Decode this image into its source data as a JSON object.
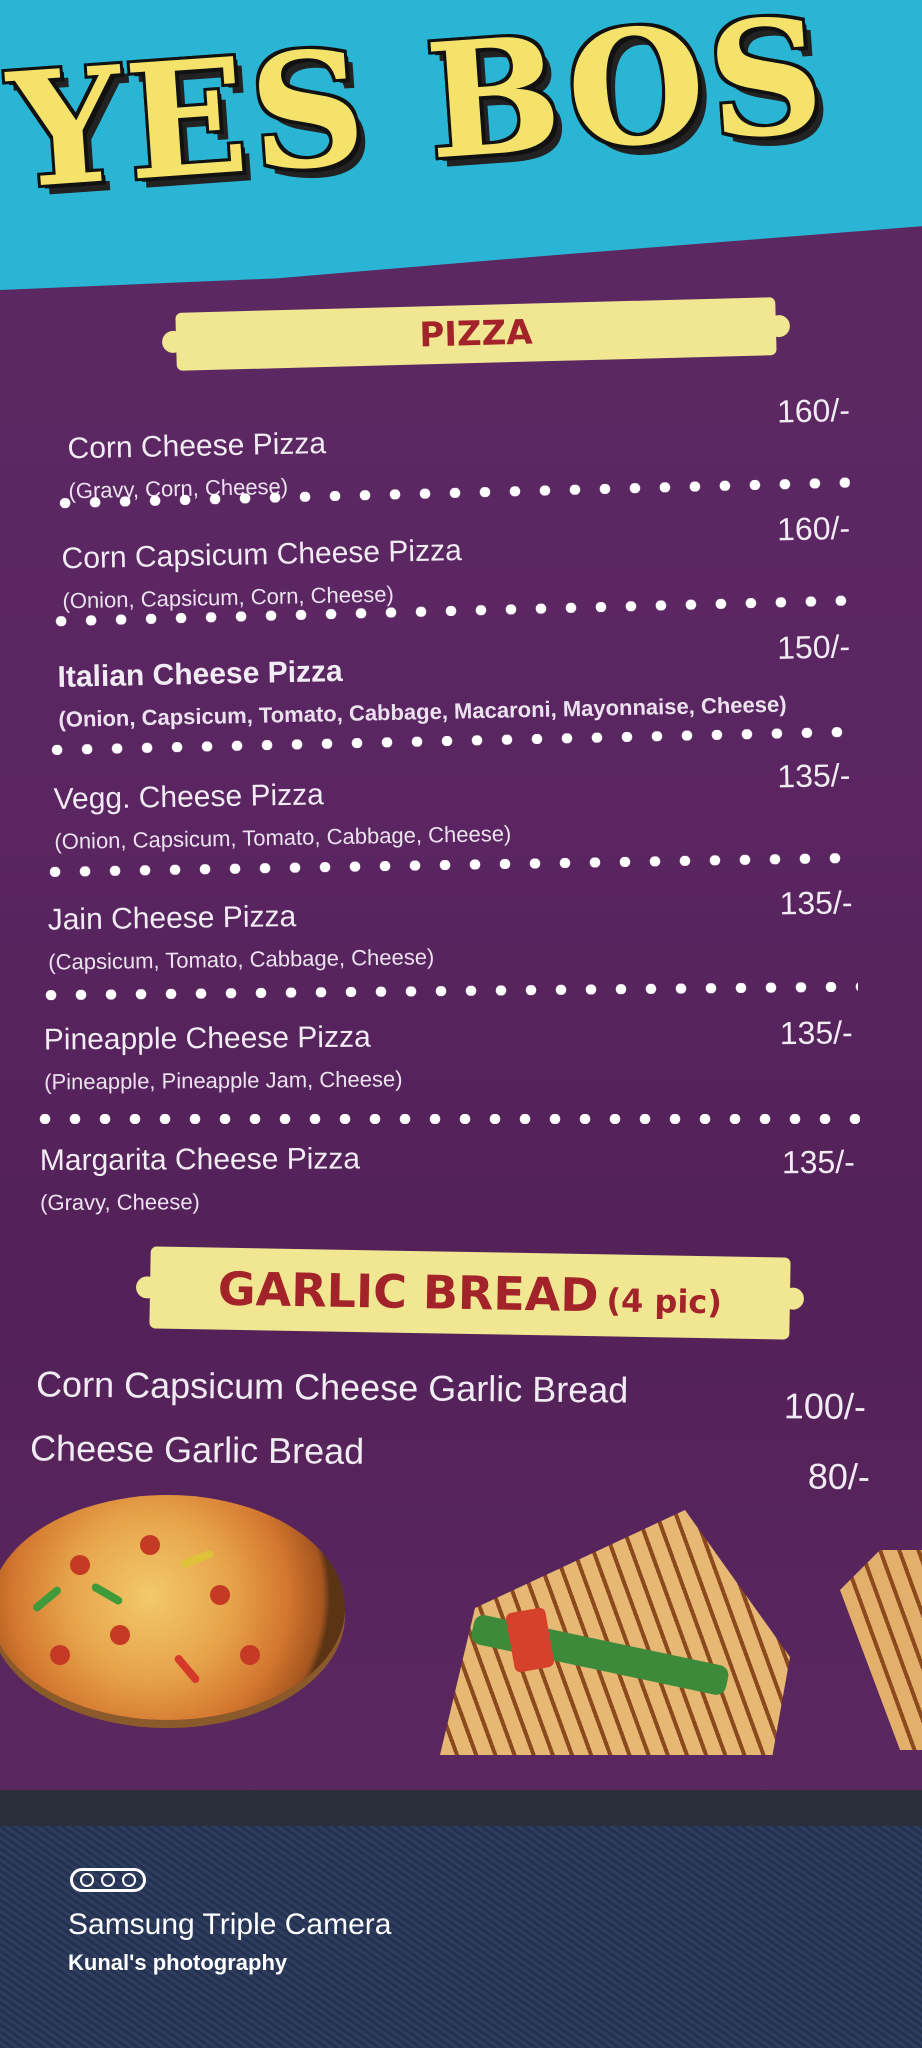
{
  "brand": {
    "title": "YES BOS"
  },
  "sections": {
    "pizza": {
      "heading": "PIZZA",
      "items": [
        {
          "name": "Corn Cheese Pizza",
          "desc": "(Gravy, Corn, Cheese)",
          "price": "160/-"
        },
        {
          "name": "Corn Capsicum Cheese Pizza",
          "desc": "(Onion, Capsicum, Corn, Cheese)",
          "price": "160/-"
        },
        {
          "name": "Italian Cheese Pizza",
          "desc": "(Onion, Capsicum, Tomato, Cabbage, Macaroni, Mayonnaise, Cheese)",
          "price": "150/-"
        },
        {
          "name": "Vegg. Cheese Pizza",
          "desc": "(Onion, Capsicum, Tomato, Cabbage, Cheese)",
          "price": "135/-"
        },
        {
          "name": "Jain Cheese Pizza",
          "desc": "(Capsicum, Tomato, Cabbage, Cheese)",
          "price": "135/-"
        },
        {
          "name": "Pineapple Cheese Pizza",
          "desc": "(Pineapple, Pineapple Jam, Cheese)",
          "price": "135/-"
        },
        {
          "name": "Margarita Cheese Pizza",
          "desc": "(Gravy, Cheese)",
          "price": "135/-"
        }
      ]
    },
    "garlic_bread": {
      "heading": "GARLIC BREAD",
      "heading_note": "(4 pic)",
      "items": [
        {
          "name": "Corn Capsicum Cheese Garlic Bread",
          "price": "100/-"
        },
        {
          "name": "Cheese Garlic Bread",
          "price": "80/-"
        }
      ]
    }
  },
  "photos": [
    "pizza-photo",
    "grilled-sandwich-photo"
  ],
  "watermark": {
    "main": "Samsung Triple Camera",
    "sub": "Kunal's photography"
  },
  "colors": {
    "banner": "#29b5d3",
    "card": "#5a2561",
    "heading_bg": "#f1e691",
    "heading_text": "#a3232a",
    "title_text": "#f4e26a"
  }
}
